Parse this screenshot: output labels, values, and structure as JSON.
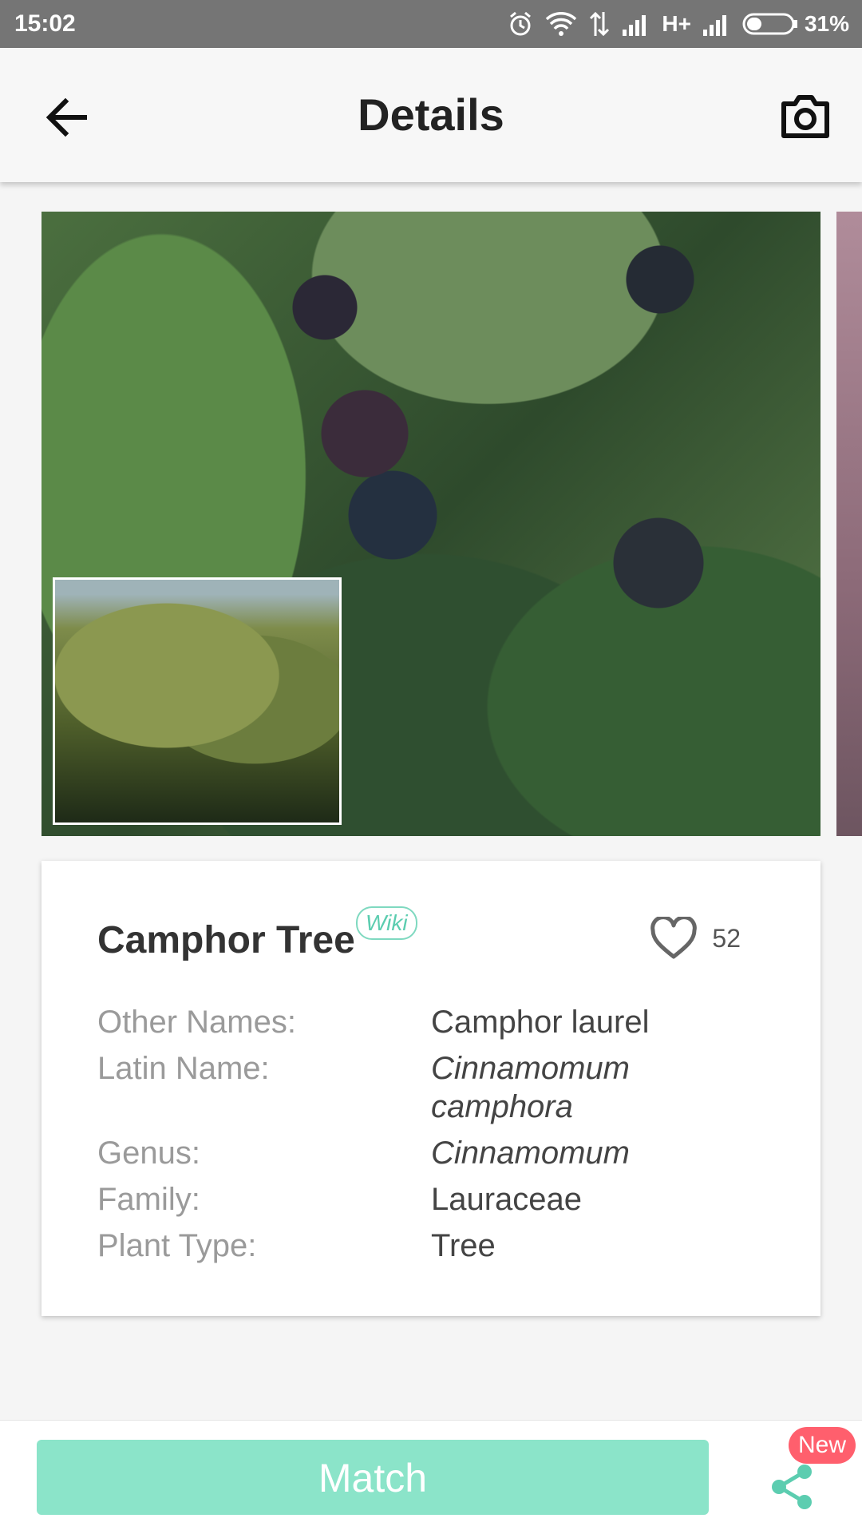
{
  "status_bar": {
    "time": "15:02",
    "network": "H+",
    "battery": "31%",
    "icons": [
      "alarm-icon",
      "wifi-icon",
      "data-transfer-icon",
      "signal-icon",
      "signal-icon",
      "battery-icon"
    ]
  },
  "header": {
    "title": "Details",
    "back_icon": "arrow-left-icon",
    "camera_icon": "camera-icon"
  },
  "plant": {
    "name": "Camphor Tree",
    "wiki_label": "Wiki",
    "likes": "52",
    "info": [
      {
        "label": "Other Names:",
        "value": "Camphor laurel",
        "italic": false
      },
      {
        "label": "Latin Name:",
        "value": "Cinnamomum camphora",
        "italic": true
      },
      {
        "label": "Genus:",
        "value": "Cinnamomum",
        "italic": true
      },
      {
        "label": "Family:",
        "value": "Lauraceae",
        "italic": false
      },
      {
        "label": "Plant Type:",
        "value": "Tree",
        "italic": false
      }
    ]
  },
  "bottom": {
    "match_label": "Match",
    "new_badge": "New",
    "share_icon": "share-icon"
  },
  "colors": {
    "accent": "#8be4c9",
    "badge": "#ff5f6d",
    "status_bar": "#757575"
  }
}
